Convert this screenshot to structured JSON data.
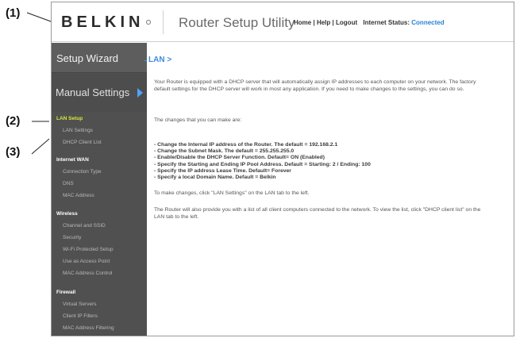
{
  "callouts": [
    "(1)",
    "(2)",
    "(3)"
  ],
  "header": {
    "logo": "BELKIN",
    "app_title": "Router Setup Utility",
    "links": {
      "home": "Home",
      "sep1": "|",
      "help": "Help",
      "sep2": "|",
      "logout": "Logout",
      "status_label": "Internet Status:",
      "status_value": "Connected"
    }
  },
  "sidebar": {
    "setup_wizard": "Setup Wizard",
    "manual_settings": "Manual Settings",
    "groups": [
      {
        "title": "LAN Setup",
        "items": [
          "LAN Settings",
          "DHCP Client List"
        ]
      },
      {
        "title": "Internet WAN",
        "items": [
          "Connection Type",
          "DNS",
          "MAC Address"
        ]
      },
      {
        "title": "Wireless",
        "items": [
          "Channel and SSID",
          "Security",
          "Wi-Fi Protected Setup",
          "Use as Access Point",
          "MAC Address Control"
        ]
      },
      {
        "title": "Firewall",
        "items": [
          "Virtual Servers",
          "Client IP Filters",
          "MAC Address Filtering"
        ]
      }
    ]
  },
  "main": {
    "title": "LAN >",
    "intro": "Your Router is equipped with a DHCP server that will automatically assign IP addresses to each computer on your network. The factory default settings for the DHCP server will work in most any application. If you need to make changes to the settings, you can do so.",
    "changes_heading": "The changes that you can make are:",
    "changes": [
      "- Change the Internal IP address of the Router. The default = 192.168.2.1",
      "- Change the Subnet Mask. The default = 255.255.255.0",
      "- Enable/Disable the DHCP Server Function. Default= ON (Enabled)",
      "- Specify the Starting and Ending IP Pool Address. Default = Starting: 2 / Ending: 100",
      "- Specify the IP address Lease Time. Default= Forever",
      "- Specify a local Domain Name. Default = Belkin"
    ],
    "instruction": "To make changes, click \"LAN Settings\" on the LAN tab to the left.",
    "client_list_note": "The Router will also provide you with a list of all client computers connected to the network. To view the list, click \"DHCP client list\" on the LAN tab to the left."
  },
  "colors": {
    "accent": "#3b8bd9",
    "status_connected": "#2a7fd4",
    "active_section": "#d8e83a",
    "sidebar_bg": "#505050"
  }
}
